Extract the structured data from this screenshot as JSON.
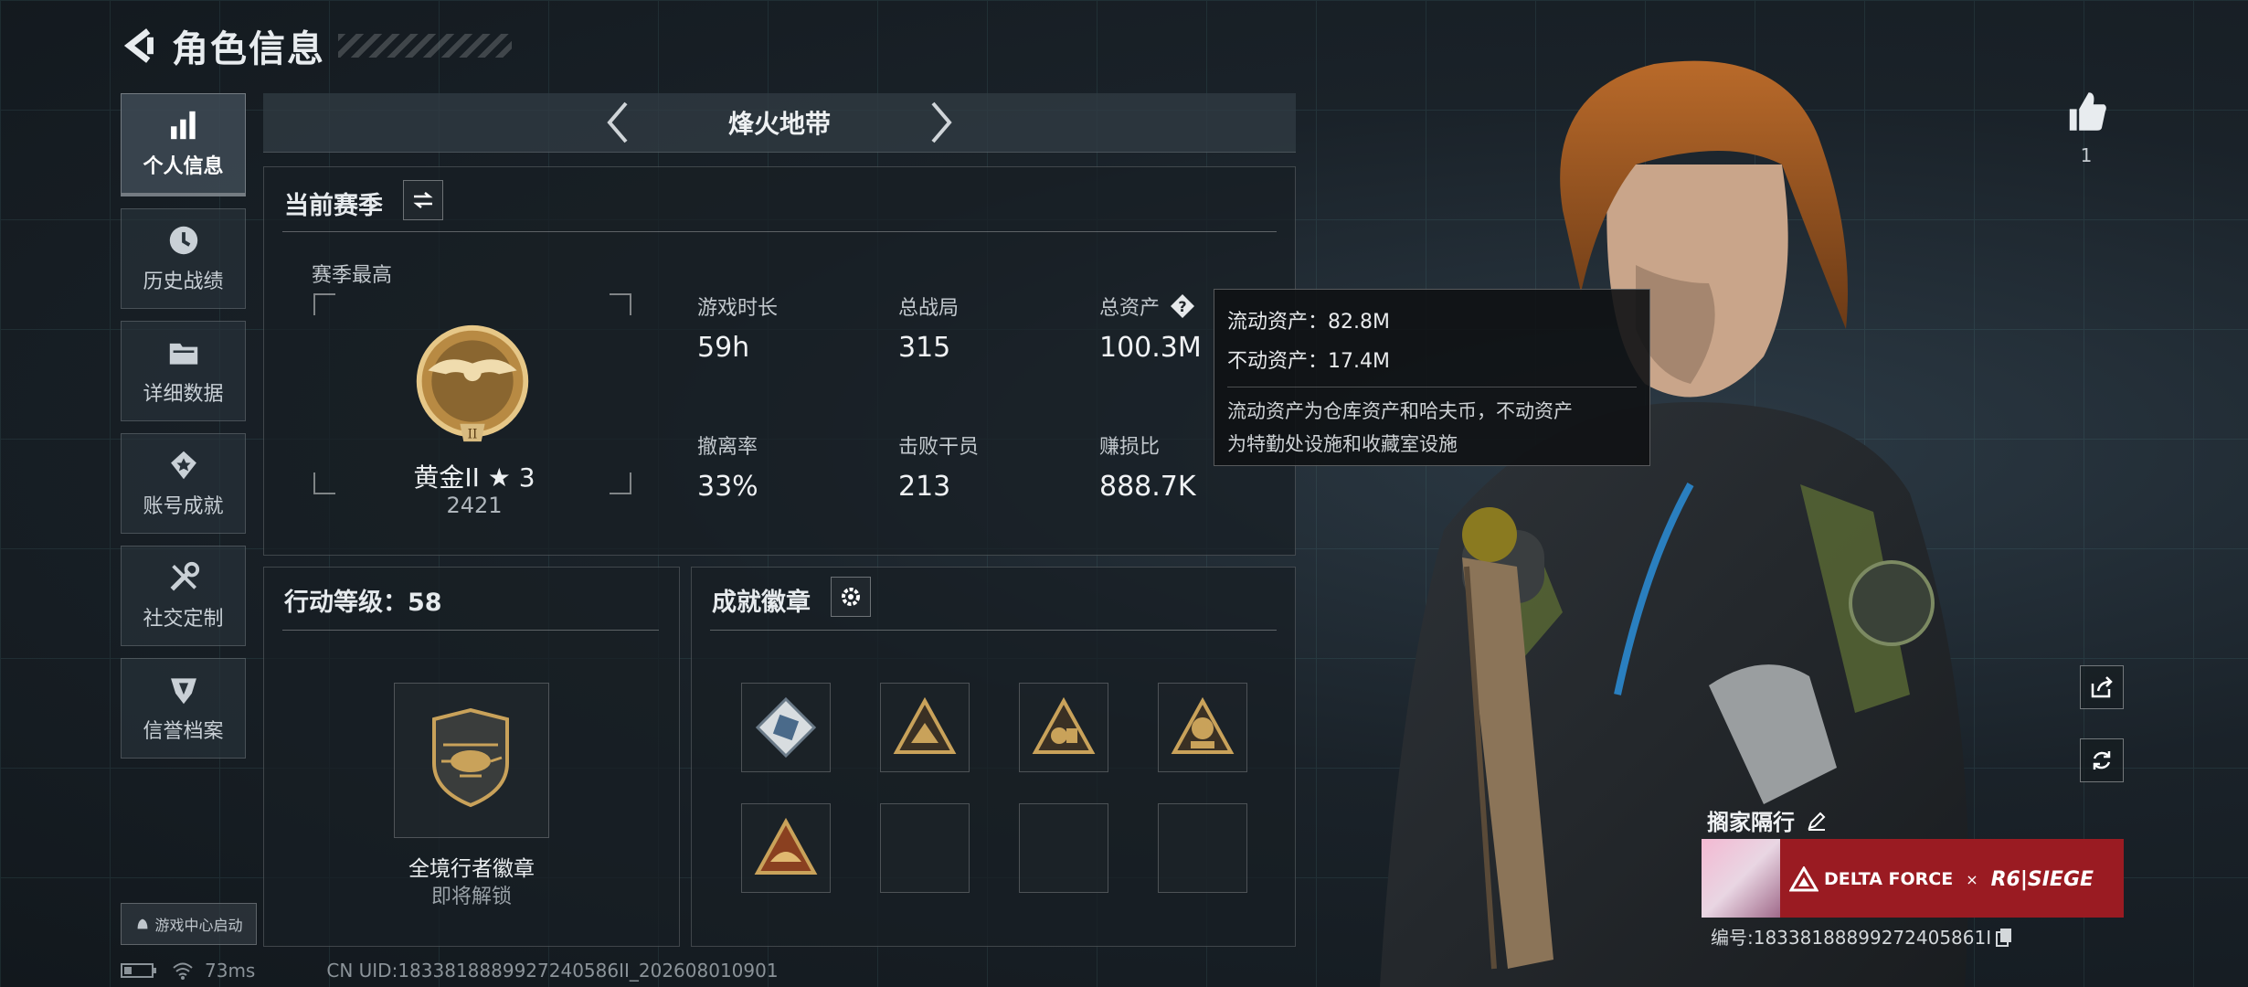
{
  "header": {
    "title": "角色信息"
  },
  "sidebar": {
    "items": [
      {
        "label": "个人信息",
        "icon": "bar-chart-icon",
        "active": true
      },
      {
        "label": "历史战绩",
        "icon": "history-icon",
        "active": false
      },
      {
        "label": "详细数据",
        "icon": "folder-icon",
        "active": false
      },
      {
        "label": "账号成就",
        "icon": "achievement-icon",
        "active": false
      },
      {
        "label": "社交定制",
        "icon": "tools-icon",
        "active": false
      },
      {
        "label": "信誉档案",
        "icon": "shield-badge-icon",
        "active": false
      }
    ],
    "launch_label": "游戏中心启动"
  },
  "mode_bar": {
    "title": "烽火地带"
  },
  "season": {
    "title": "当前赛季",
    "best_label": "赛季最高",
    "rank_name": "黄金II ★ 3",
    "rank_score": "2421",
    "stats": [
      {
        "label": "游戏时长",
        "value": "59h"
      },
      {
        "label": "总战局",
        "value": "315"
      },
      {
        "label": "总资产",
        "value": "100.3M"
      },
      {
        "label": "撤离率",
        "value": "33%"
      },
      {
        "label": "击败干员",
        "value": "213"
      },
      {
        "label": "赚损比",
        "value": "888.7K"
      }
    ]
  },
  "tooltip": {
    "liquid": "流动资产：82.8M",
    "fixed": "不动资产：17.4M",
    "desc_1": "流动资产为仓库资产和哈夫币，不动资产",
    "desc_2": "为特勤处设施和收藏室设施"
  },
  "action_level": {
    "title": "行动等级：58",
    "badge_name": "全境行者徽章",
    "badge_status": "即将解锁"
  },
  "achievements": {
    "title": "成就徽章",
    "badges": [
      "diamond-badge-icon",
      "triangle-badge-icon",
      "triangle-badge-icon",
      "triangle-badge-icon",
      "triangle-badge-icon",
      "",
      "",
      ""
    ]
  },
  "status_bar": {
    "ping": "73ms",
    "uid": "CN UID:1833818889927240586II_202608010901"
  },
  "profile": {
    "likes": "1",
    "name": "搁家隔行",
    "player_id": "编号:18338188899272405861I",
    "card_brand": "DELTA FORCE",
    "card_cross": "×",
    "card_collab": "R6|SIEGE"
  },
  "colors": {
    "accent_green": "#3ed18a",
    "card_red": "#9a1b22",
    "gold": "#c9a25a"
  }
}
